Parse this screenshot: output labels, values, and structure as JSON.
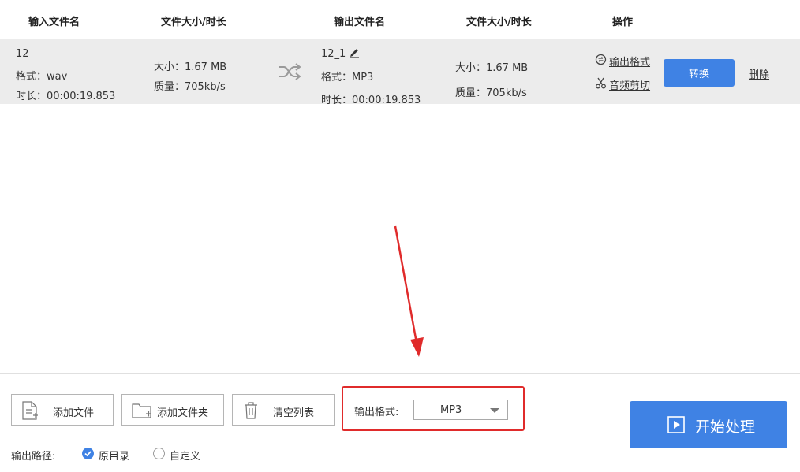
{
  "header": {
    "input_name": "输入文件名",
    "input_size_duration": "文件大小/时长",
    "output_name": "输出文件名",
    "output_size_duration": "文件大小/时长",
    "actions": "操作"
  },
  "file_row": {
    "input": {
      "name": "12",
      "format": "格式：wav",
      "duration": "时长：00:00:19.853",
      "size": "大小：1.67 MB",
      "quality": "质量：705kb/s"
    },
    "output": {
      "name": "12_1",
      "format": "格式：MP3",
      "duration": "时长：00:00:19.853",
      "size": "大小：1.67 MB",
      "quality": "质量：705kb/s"
    },
    "actions": {
      "output_format": "输出格式",
      "audio_cut": "音频剪切",
      "convert": "转换",
      "delete": "删除"
    }
  },
  "toolbar": {
    "add_file": "添加文件",
    "add_folder": "添加文件夹",
    "clear_list": "清空列表",
    "output_format_label": "输出格式:",
    "output_format_value": "MP3",
    "start": "开始处理"
  },
  "output_path": {
    "label": "输出路径:",
    "options": [
      {
        "label": "原目录",
        "selected": true
      },
      {
        "label": "自定义",
        "selected": false
      }
    ]
  },
  "colors": {
    "accent": "#3f82e4",
    "highlight": "#e02b2b",
    "row_bg": "#ececec"
  },
  "icons": [
    "shuffle-icon",
    "pencil-icon",
    "output-format-icon",
    "scissors-icon",
    "add-file-icon",
    "add-folder-icon",
    "trash-icon",
    "play-icon",
    "red-arrow"
  ]
}
